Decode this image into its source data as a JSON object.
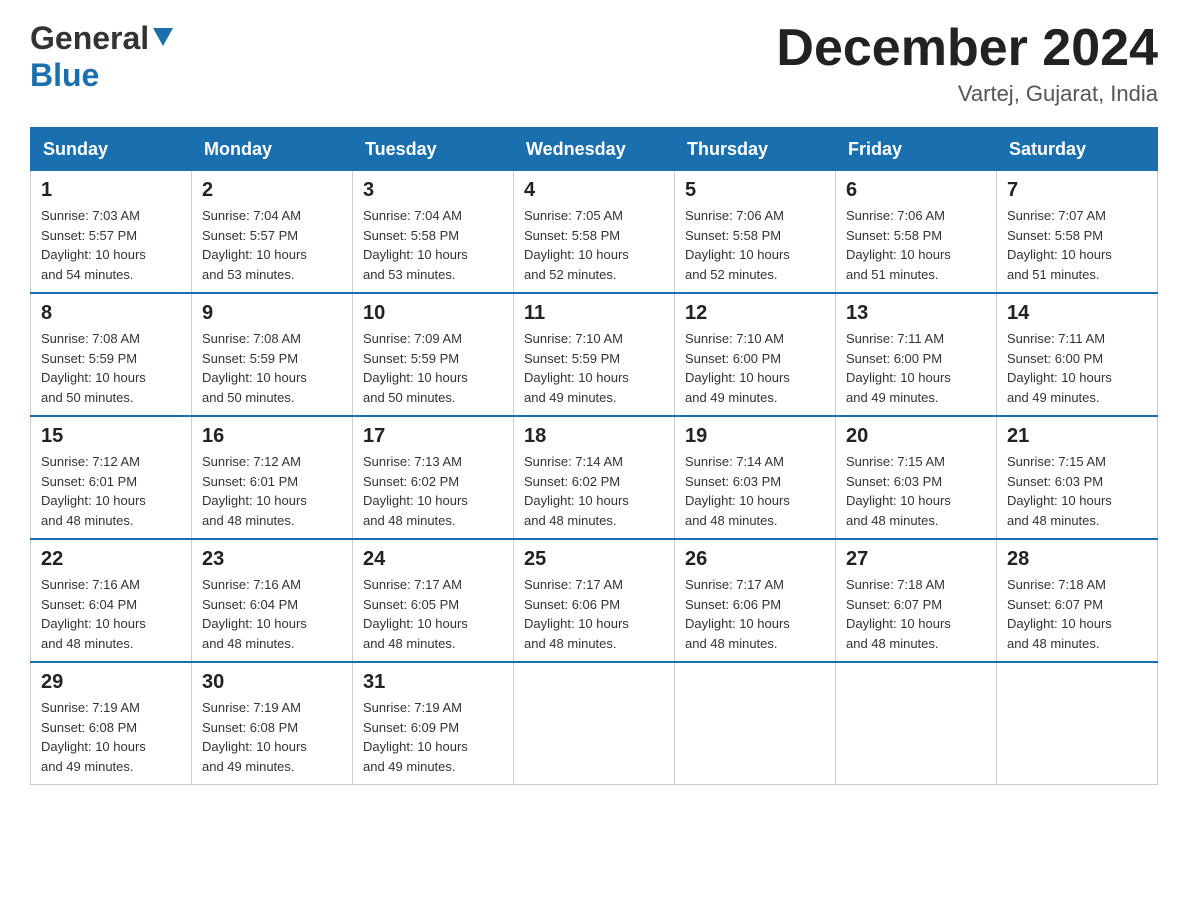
{
  "header": {
    "month_title": "December 2024",
    "location": "Vartej, Gujarat, India",
    "logo_general": "General",
    "logo_blue": "Blue"
  },
  "weekdays": [
    "Sunday",
    "Monday",
    "Tuesday",
    "Wednesday",
    "Thursday",
    "Friday",
    "Saturday"
  ],
  "weeks": [
    [
      {
        "day": "1",
        "sunrise": "7:03 AM",
        "sunset": "5:57 PM",
        "daylight": "10 hours and 54 minutes."
      },
      {
        "day": "2",
        "sunrise": "7:04 AM",
        "sunset": "5:57 PM",
        "daylight": "10 hours and 53 minutes."
      },
      {
        "day": "3",
        "sunrise": "7:04 AM",
        "sunset": "5:58 PM",
        "daylight": "10 hours and 53 minutes."
      },
      {
        "day": "4",
        "sunrise": "7:05 AM",
        "sunset": "5:58 PM",
        "daylight": "10 hours and 52 minutes."
      },
      {
        "day": "5",
        "sunrise": "7:06 AM",
        "sunset": "5:58 PM",
        "daylight": "10 hours and 52 minutes."
      },
      {
        "day": "6",
        "sunrise": "7:06 AM",
        "sunset": "5:58 PM",
        "daylight": "10 hours and 51 minutes."
      },
      {
        "day": "7",
        "sunrise": "7:07 AM",
        "sunset": "5:58 PM",
        "daylight": "10 hours and 51 minutes."
      }
    ],
    [
      {
        "day": "8",
        "sunrise": "7:08 AM",
        "sunset": "5:59 PM",
        "daylight": "10 hours and 50 minutes."
      },
      {
        "day": "9",
        "sunrise": "7:08 AM",
        "sunset": "5:59 PM",
        "daylight": "10 hours and 50 minutes."
      },
      {
        "day": "10",
        "sunrise": "7:09 AM",
        "sunset": "5:59 PM",
        "daylight": "10 hours and 50 minutes."
      },
      {
        "day": "11",
        "sunrise": "7:10 AM",
        "sunset": "5:59 PM",
        "daylight": "10 hours and 49 minutes."
      },
      {
        "day": "12",
        "sunrise": "7:10 AM",
        "sunset": "6:00 PM",
        "daylight": "10 hours and 49 minutes."
      },
      {
        "day": "13",
        "sunrise": "7:11 AM",
        "sunset": "6:00 PM",
        "daylight": "10 hours and 49 minutes."
      },
      {
        "day": "14",
        "sunrise": "7:11 AM",
        "sunset": "6:00 PM",
        "daylight": "10 hours and 49 minutes."
      }
    ],
    [
      {
        "day": "15",
        "sunrise": "7:12 AM",
        "sunset": "6:01 PM",
        "daylight": "10 hours and 48 minutes."
      },
      {
        "day": "16",
        "sunrise": "7:12 AM",
        "sunset": "6:01 PM",
        "daylight": "10 hours and 48 minutes."
      },
      {
        "day": "17",
        "sunrise": "7:13 AM",
        "sunset": "6:02 PM",
        "daylight": "10 hours and 48 minutes."
      },
      {
        "day": "18",
        "sunrise": "7:14 AM",
        "sunset": "6:02 PM",
        "daylight": "10 hours and 48 minutes."
      },
      {
        "day": "19",
        "sunrise": "7:14 AM",
        "sunset": "6:03 PM",
        "daylight": "10 hours and 48 minutes."
      },
      {
        "day": "20",
        "sunrise": "7:15 AM",
        "sunset": "6:03 PM",
        "daylight": "10 hours and 48 minutes."
      },
      {
        "day": "21",
        "sunrise": "7:15 AM",
        "sunset": "6:03 PM",
        "daylight": "10 hours and 48 minutes."
      }
    ],
    [
      {
        "day": "22",
        "sunrise": "7:16 AM",
        "sunset": "6:04 PM",
        "daylight": "10 hours and 48 minutes."
      },
      {
        "day": "23",
        "sunrise": "7:16 AM",
        "sunset": "6:04 PM",
        "daylight": "10 hours and 48 minutes."
      },
      {
        "day": "24",
        "sunrise": "7:17 AM",
        "sunset": "6:05 PM",
        "daylight": "10 hours and 48 minutes."
      },
      {
        "day": "25",
        "sunrise": "7:17 AM",
        "sunset": "6:06 PM",
        "daylight": "10 hours and 48 minutes."
      },
      {
        "day": "26",
        "sunrise": "7:17 AM",
        "sunset": "6:06 PM",
        "daylight": "10 hours and 48 minutes."
      },
      {
        "day": "27",
        "sunrise": "7:18 AM",
        "sunset": "6:07 PM",
        "daylight": "10 hours and 48 minutes."
      },
      {
        "day": "28",
        "sunrise": "7:18 AM",
        "sunset": "6:07 PM",
        "daylight": "10 hours and 48 minutes."
      }
    ],
    [
      {
        "day": "29",
        "sunrise": "7:19 AM",
        "sunset": "6:08 PM",
        "daylight": "10 hours and 49 minutes."
      },
      {
        "day": "30",
        "sunrise": "7:19 AM",
        "sunset": "6:08 PM",
        "daylight": "10 hours and 49 minutes."
      },
      {
        "day": "31",
        "sunrise": "7:19 AM",
        "sunset": "6:09 PM",
        "daylight": "10 hours and 49 minutes."
      },
      null,
      null,
      null,
      null
    ]
  ]
}
